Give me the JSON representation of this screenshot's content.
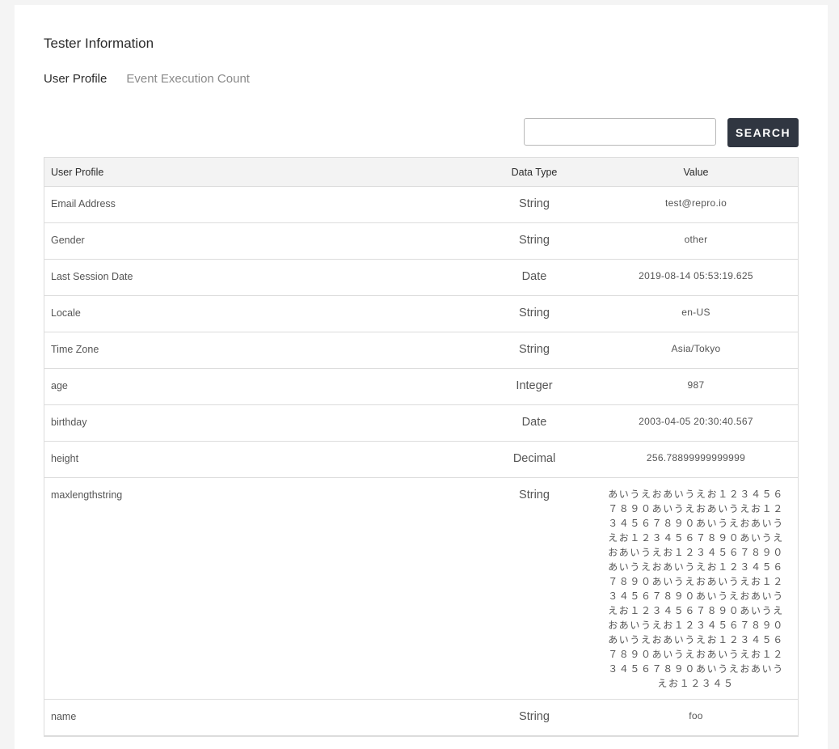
{
  "page_title": "Tester Information",
  "tabs": [
    {
      "label": "User Profile",
      "active": true
    },
    {
      "label": "Event Execution Count",
      "active": false
    }
  ],
  "search": {
    "value": "",
    "placeholder": "",
    "button_label": "SEARCH"
  },
  "table": {
    "headers": {
      "name": "User Profile",
      "type": "Data Type",
      "value": "Value"
    },
    "rows": [
      {
        "name": "Email Address",
        "type": "String",
        "value": "test@repro.io"
      },
      {
        "name": "Gender",
        "type": "String",
        "value": "other"
      },
      {
        "name": "Last Session Date",
        "type": "Date",
        "value": "2019-08-14 05:53:19.625"
      },
      {
        "name": "Locale",
        "type": "String",
        "value": "en-US"
      },
      {
        "name": "Time Zone",
        "type": "String",
        "value": "Asia/Tokyo"
      },
      {
        "name": "age",
        "type": "Integer",
        "value": "987"
      },
      {
        "name": "birthday",
        "type": "Date",
        "value": "2003-04-05 20:30:40.567"
      },
      {
        "name": "height",
        "type": "Decimal",
        "value": "256.78899999999999"
      },
      {
        "name": "maxlengthstring",
        "type": "String",
        "value": "あいうえおあいうえお１２３４５６７８９０あいうえおあいうえお１２３４５６７８９０あいうえおあいうえお１２３４５６７８９０あいうえおあいうえお１２３４５６７８９０あいうえおあいうえお１２３４５６７８９０あいうえおあいうえお１２３４５６７８９０あいうえおあいうえお１２３４５６７８９０あいうえおあいうえお１２３４５６７８９０あいうえおあいうえお１２３４５６７８９０あいうえおあいうえお１２３４５６７８９０あいうえおあいうえお１２３４５"
      },
      {
        "name": "name",
        "type": "String",
        "value": "foo"
      }
    ]
  }
}
